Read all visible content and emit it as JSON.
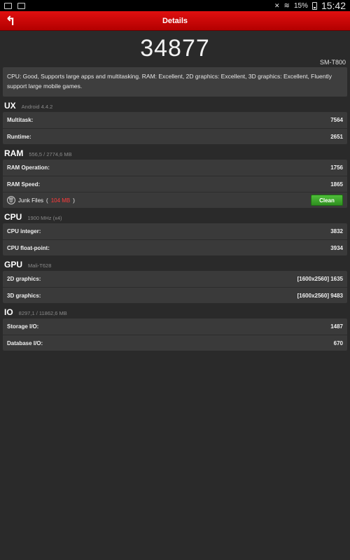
{
  "status_bar": {
    "battery_percent": "15%",
    "time": "15:42"
  },
  "header": {
    "title": "Details"
  },
  "score": {
    "value": "34877",
    "model": "SM-T800"
  },
  "summary": "CPU: Good, Supports large apps and multitasking. RAM: Excellent, 2D graphics: Excellent, 3D graphics: Excellent, Fluently support large mobile games.",
  "ux": {
    "title": "UX",
    "subtitle": "Android 4.4.2",
    "rows": [
      {
        "label": "Multitask:",
        "value": "7564"
      },
      {
        "label": "Runtime:",
        "value": "2651"
      }
    ]
  },
  "ram": {
    "title": "RAM",
    "subtitle": "556,5 / 2774,6 MB",
    "rows": [
      {
        "label": "RAM Operation:",
        "value": "1756"
      },
      {
        "label": "RAM Speed:",
        "value": "1865"
      }
    ],
    "junk": {
      "label": "Junk Files",
      "open": "(",
      "size": "104 MB",
      "close": ")",
      "button": "Clean"
    }
  },
  "cpu": {
    "title": "CPU",
    "subtitle": "1900 MHz (x4)",
    "rows": [
      {
        "label": "CPU integer:",
        "value": "3832"
      },
      {
        "label": "CPU float-point:",
        "value": "3934"
      }
    ]
  },
  "gpu": {
    "title": "GPU",
    "subtitle": "Mali-T628",
    "rows": [
      {
        "label": "2D graphics:",
        "value": "[1600x2560] 1635"
      },
      {
        "label": "3D graphics:",
        "value": "[1600x2560] 9483"
      }
    ]
  },
  "io": {
    "title": "IO",
    "subtitle": "8297,1 / 11862,6 MB",
    "rows": [
      {
        "label": "Storage I/O:",
        "value": "1487"
      },
      {
        "label": "Database I/O:",
        "value": "670"
      }
    ]
  },
  "colors": {
    "header_red": "#cc0000",
    "clean_green": "#3aa52a",
    "junk_red": "#ff3b3b"
  }
}
